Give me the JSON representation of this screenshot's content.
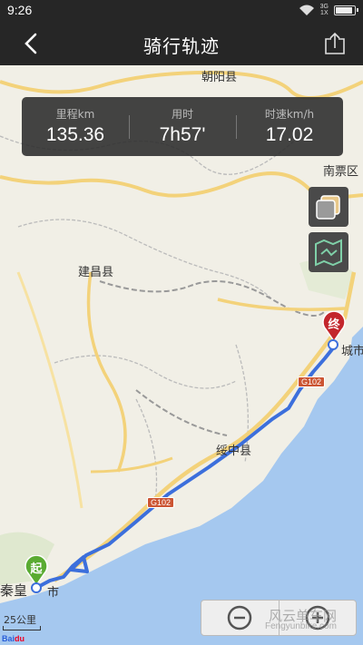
{
  "status": {
    "time": "9:26",
    "net_top": "3G",
    "net_bottom": "1X"
  },
  "header": {
    "title": "骑行轨迹"
  },
  "stats": [
    {
      "label": "里程km",
      "value": "135.36"
    },
    {
      "label": "用时",
      "value": "7h57'"
    },
    {
      "label": "时速km/h",
      "value": "17.02"
    }
  ],
  "map": {
    "labels": {
      "chaoyang": "朝阳县",
      "nanpiao": "南票区",
      "jianchang": "建昌县",
      "suizhong": "绥中县",
      "city_end": "城市",
      "qinhuang": "秦皇",
      "city_start_suffix": "市"
    },
    "highway_1": "G102",
    "highway_2": "G102",
    "start_marker": "起",
    "end_marker": "终",
    "scale": "25公里",
    "logo_a": "Bai",
    "logo_b": "du",
    "watermark": "风云单车网",
    "watermark_url": "Fengyunbike.com"
  }
}
